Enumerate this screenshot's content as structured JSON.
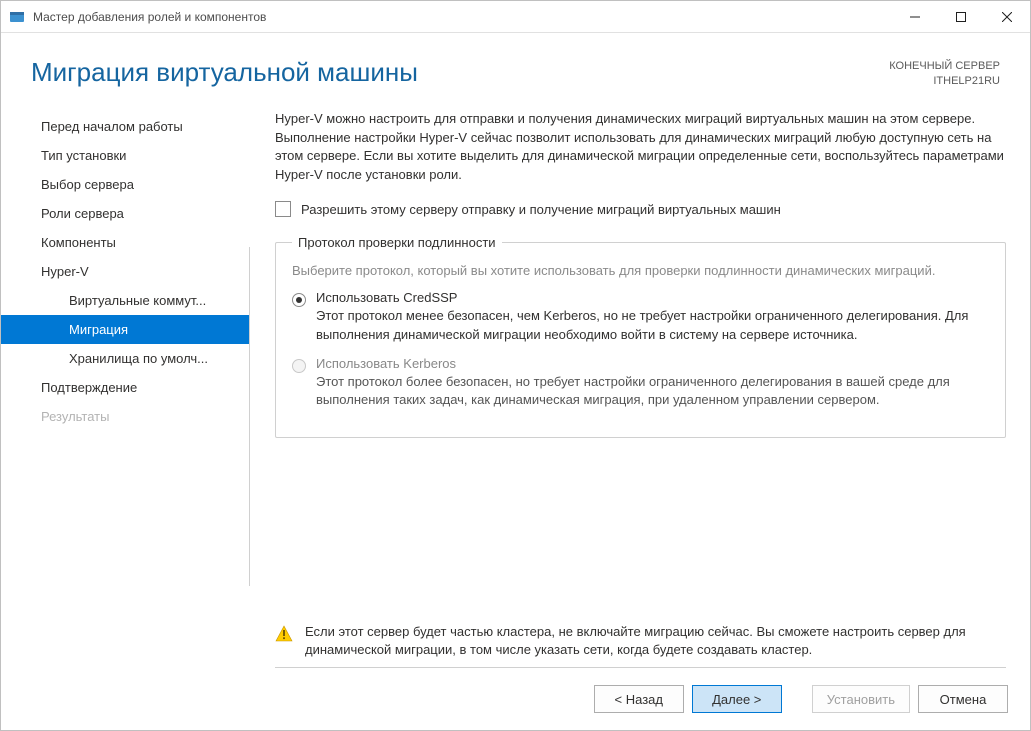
{
  "window": {
    "title": "Мастер добавления ролей и компонентов"
  },
  "header": {
    "title": "Миграция виртуальной машины",
    "server_label": "КОНЕЧНЫЙ СЕРВЕР",
    "server_name": "ITHELP21RU"
  },
  "sidebar": {
    "items": [
      {
        "label": "Перед началом работы",
        "level": 0
      },
      {
        "label": "Тип установки",
        "level": 0
      },
      {
        "label": "Выбор сервера",
        "level": 0
      },
      {
        "label": "Роли сервера",
        "level": 0
      },
      {
        "label": "Компоненты",
        "level": 0
      },
      {
        "label": "Hyper-V",
        "level": 0
      },
      {
        "label": "Виртуальные коммут...",
        "level": 1
      },
      {
        "label": "Миграция",
        "level": 1,
        "selected": true
      },
      {
        "label": "Хранилища по умолч...",
        "level": 1
      },
      {
        "label": "Подтверждение",
        "level": 0
      },
      {
        "label": "Результаты",
        "level": 0,
        "disabled": true
      }
    ]
  },
  "content": {
    "intro": "Hyper-V можно настроить для отправки и получения динамических миграций виртуальных машин на этом сервере. Выполнение настройки Hyper-V сейчас позволит использовать для динамических миграций любую доступную сеть на этом сервере. Если вы хотите выделить для динамической миграции определенные сети, воспользуйтесь параметрами Hyper-V после установки роли.",
    "checkbox_label": "Разрешить этому серверу отправку и получение миграций виртуальных машин",
    "group_title": "Протокол проверки подлинности",
    "group_help": "Выберите протокол, который вы хотите использовать для проверки подлинности динамических миграций.",
    "options": [
      {
        "label": "Использовать CredSSP",
        "desc": "Этот протокол менее безопасен, чем Kerberos, но не требует настройки ограниченного делегирования. Для выполнения динамической миграции необходимо войти в систему на сервере источника.",
        "checked": true,
        "disabled": false
      },
      {
        "label": "Использовать Kerberos",
        "desc": "Этот протокол более безопасен, но требует настройки ограниченного делегирования в вашей среде для выполнения таких задач, как динамическая миграция, при удаленном управлении сервером.",
        "checked": false,
        "disabled": true
      }
    ],
    "note": "Если этот сервер будет частью кластера, не включайте миграцию сейчас. Вы сможете настроить сервер для динамической миграции, в том числе указать сети, когда будете создавать кластер."
  },
  "footer": {
    "back": "< Назад",
    "next": "Далее >",
    "install": "Установить",
    "cancel": "Отмена"
  }
}
